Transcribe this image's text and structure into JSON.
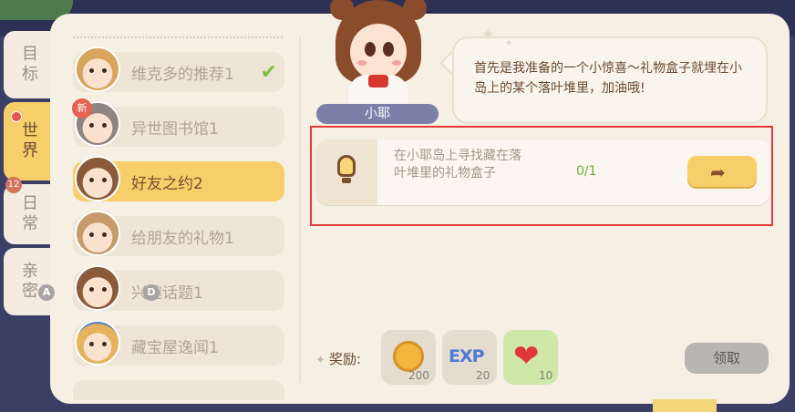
{
  "tabs": [
    {
      "label": "目标"
    },
    {
      "label": "世界"
    },
    {
      "label": "日常",
      "badge": "12"
    },
    {
      "label": "亲密"
    }
  ],
  "quests": [
    {
      "label": "维克多的推荐1",
      "completed": true
    },
    {
      "label": "异世图书馆1",
      "badge": "新"
    },
    {
      "label": "好友之约2",
      "selected": true
    },
    {
      "label": "给朋友的礼物1"
    },
    {
      "label": "兴趣话题1"
    },
    {
      "label": "藏宝屋逸闻1"
    }
  ],
  "letters": {
    "a": "A",
    "d": "D"
  },
  "npc": {
    "name": "小耶",
    "dialogue": "首先是我准备的一个小惊喜～礼物盒子就埋在小岛上的某个落叶堆里，加油哦!"
  },
  "task": {
    "description": "在小耶岛上寻找藏在落叶堆里的礼物盒子",
    "progress": "0/1",
    "icon": "lightbulb-icon"
  },
  "rewards": {
    "label": "奖励:",
    "items": [
      {
        "icon": "coin-icon",
        "count": "200"
      },
      {
        "icon": "exp-icon",
        "text": "EXP",
        "count": "20"
      },
      {
        "icon": "heart-icon",
        "count": "10"
      }
    ]
  },
  "claim_button": "领取",
  "colors": {
    "accent": "#f7cf6a",
    "highlight_frame": "#e23a37",
    "progress": "#6fae3c"
  }
}
